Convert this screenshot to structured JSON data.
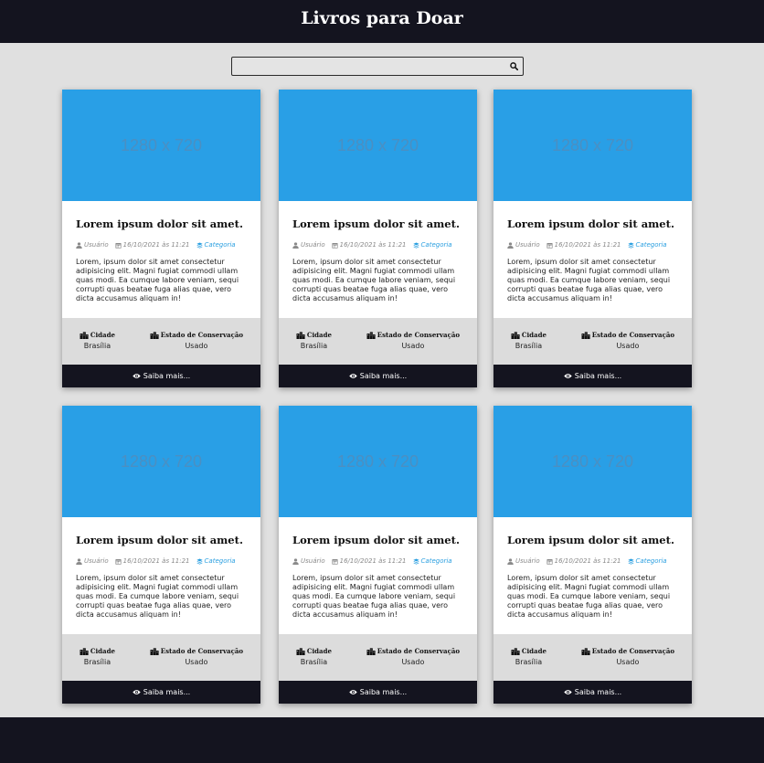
{
  "header": {
    "title": "Livros para Doar"
  },
  "search": {
    "value": "",
    "placeholder": "",
    "icon": "search-icon"
  },
  "colors": {
    "dark": "#14141f",
    "accent": "#299fe6",
    "background": "#e0e0e0"
  },
  "cards": [
    {
      "image_text": "1280 x 720",
      "title": "Lorem ipsum dolor sit amet.",
      "user": "Usuário",
      "date": "16/10/2021 às 11:21",
      "category": "Categoria",
      "description": "Lorem, ipsum dolor sit amet consectetur adipisicing elit. Magni fugiat commodi ullam quas modi. Ea cumque labore veniam, sequi corrupti quas beatae fuga alias quae, vero dicta accusamus aliquam in!",
      "city_label": "Cidade",
      "city": "Brasília",
      "condition_label": "Estado de Conservação",
      "condition": "Usado",
      "more_label": "Saiba mais..."
    },
    {
      "image_text": "1280 x 720",
      "title": "Lorem ipsum dolor sit amet.",
      "user": "Usuário",
      "date": "16/10/2021 às 11:21",
      "category": "Categoria",
      "description": "Lorem, ipsum dolor sit amet consectetur adipisicing elit. Magni fugiat commodi ullam quas modi. Ea cumque labore veniam, sequi corrupti quas beatae fuga alias quae, vero dicta accusamus aliquam in!",
      "city_label": "Cidade",
      "city": "Brasília",
      "condition_label": "Estado de Conservação",
      "condition": "Usado",
      "more_label": "Saiba mais..."
    },
    {
      "image_text": "1280 x 720",
      "title": "Lorem ipsum dolor sit amet.",
      "user": "Usuário",
      "date": "16/10/2021 às 11:21",
      "category": "Categoria",
      "description": "Lorem, ipsum dolor sit amet consectetur adipisicing elit. Magni fugiat commodi ullam quas modi. Ea cumque labore veniam, sequi corrupti quas beatae fuga alias quae, vero dicta accusamus aliquam in!",
      "city_label": "Cidade",
      "city": "Brasília",
      "condition_label": "Estado de Conservação",
      "condition": "Usado",
      "more_label": "Saiba mais..."
    },
    {
      "image_text": "1280 x 720",
      "title": "Lorem ipsum dolor sit amet.",
      "user": "Usuário",
      "date": "16/10/2021 às 11:21",
      "category": "Categoria",
      "description": "Lorem, ipsum dolor sit amet consectetur adipisicing elit. Magni fugiat commodi ullam quas modi. Ea cumque labore veniam, sequi corrupti quas beatae fuga alias quae, vero dicta accusamus aliquam in!",
      "city_label": "Cidade",
      "city": "Brasília",
      "condition_label": "Estado de Conservação",
      "condition": "Usado",
      "more_label": "Saiba mais..."
    },
    {
      "image_text": "1280 x 720",
      "title": "Lorem ipsum dolor sit amet.",
      "user": "Usuário",
      "date": "16/10/2021 às 11:21",
      "category": "Categoria",
      "description": "Lorem, ipsum dolor sit amet consectetur adipisicing elit. Magni fugiat commodi ullam quas modi. Ea cumque labore veniam, sequi corrupti quas beatae fuga alias quae, vero dicta accusamus aliquam in!",
      "city_label": "Cidade",
      "city": "Brasília",
      "condition_label": "Estado de Conservação",
      "condition": "Usado",
      "more_label": "Saiba mais..."
    },
    {
      "image_text": "1280 x 720",
      "title": "Lorem ipsum dolor sit amet.",
      "user": "Usuário",
      "date": "16/10/2021 às 11:21",
      "category": "Categoria",
      "description": "Lorem, ipsum dolor sit amet consectetur adipisicing elit. Magni fugiat commodi ullam quas modi. Ea cumque labore veniam, sequi corrupti quas beatae fuga alias quae, vero dicta accusamus aliquam in!",
      "city_label": "Cidade",
      "city": "Brasília",
      "condition_label": "Estado de Conservação",
      "condition": "Usado",
      "more_label": "Saiba mais..."
    }
  ]
}
